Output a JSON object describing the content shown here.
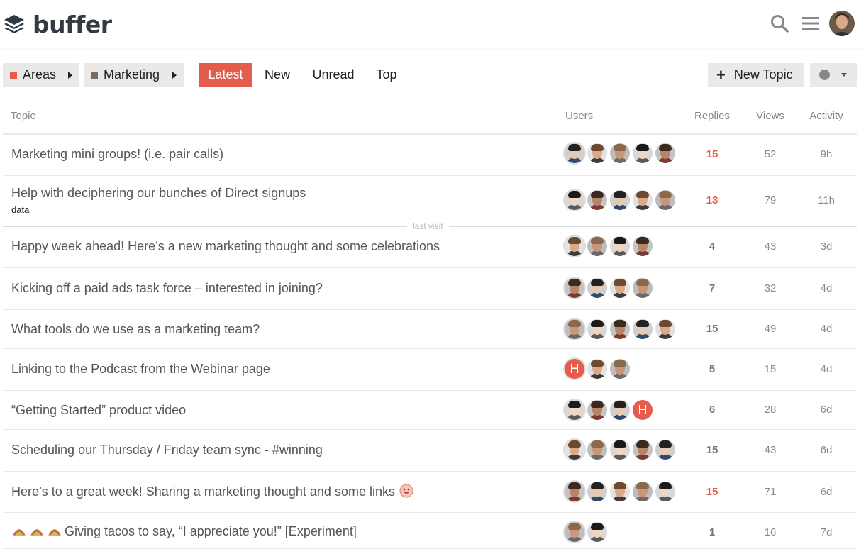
{
  "brand": {
    "name": "buffer"
  },
  "colors": {
    "accent": "#e45c4b",
    "areas": "#e45c4b",
    "marketing": "#7a6a5e",
    "hot_reply": "#e45c4b"
  },
  "nav": {
    "breadcrumbs": [
      {
        "label": "Areas"
      },
      {
        "label": "Marketing"
      }
    ],
    "tabs": [
      {
        "label": "Latest",
        "active": true
      },
      {
        "label": "New"
      },
      {
        "label": "Unread"
      },
      {
        "label": "Top"
      }
    ],
    "new_topic_label": "New Topic"
  },
  "columns": {
    "topic": "Topic",
    "users": "Users",
    "replies": "Replies",
    "views": "Views",
    "activity": "Activity"
  },
  "last_visit_label": "last visit",
  "topics": [
    {
      "title": "Marketing mini groups! (i.e. pair calls)",
      "tag": "",
      "posters": [
        "avatar",
        "avatar",
        "avatar",
        "avatar",
        "avatar"
      ],
      "replies": "15",
      "hot": true,
      "views": "52",
      "activity": "9h"
    },
    {
      "title": "Help with deciphering our bunches of Direct signups",
      "tag": "data",
      "posters": [
        "avatar",
        "avatar",
        "avatar",
        "avatar",
        "avatar"
      ],
      "replies": "13",
      "hot": true,
      "views": "79",
      "activity": "11h"
    },
    {
      "title": "Happy week ahead! Here’s a new marketing thought and some celebrations",
      "tag": "",
      "posters": [
        "avatar",
        "avatar",
        "avatar",
        "avatar"
      ],
      "replies": "4",
      "hot": false,
      "views": "43",
      "activity": "3d"
    },
    {
      "title": "Kicking off a paid ads task force – interested in joining?",
      "tag": "",
      "posters": [
        "avatar",
        "avatar",
        "avatar",
        "avatar"
      ],
      "replies": "7",
      "hot": false,
      "views": "32",
      "activity": "4d"
    },
    {
      "title": "What tools do we use as a marketing team?",
      "tag": "",
      "posters": [
        "avatar",
        "avatar",
        "avatar",
        "avatar",
        "avatar"
      ],
      "replies": "15",
      "hot": false,
      "views": "49",
      "activity": "4d"
    },
    {
      "title": "Linking to the Podcast from the Webinar page",
      "tag": "",
      "posters": [
        "H",
        "avatar",
        "avatar"
      ],
      "replies": "5",
      "hot": false,
      "views": "15",
      "activity": "4d"
    },
    {
      "title": "“Getting Started” product video",
      "tag": "",
      "posters": [
        "avatar",
        "avatar",
        "avatar",
        "H"
      ],
      "replies": "6",
      "hot": false,
      "views": "28",
      "activity": "6d"
    },
    {
      "title": "Scheduling our Thursday / Friday team sync - #winning",
      "tag": "",
      "posters": [
        "avatar",
        "avatar",
        "avatar",
        "avatar",
        "avatar"
      ],
      "replies": "15",
      "hot": false,
      "views": "43",
      "activity": "6d"
    },
    {
      "title": "Here’s to a great week! Sharing a marketing thought and some links",
      "tag": "",
      "posters": [
        "avatar",
        "avatar",
        "avatar",
        "avatar",
        "avatar"
      ],
      "replies": "15",
      "hot": true,
      "views": "71",
      "activity": "6d"
    },
    {
      "title": "Giving tacos to say, “I appreciate you!” [Experiment]",
      "tag": "",
      "posters": [
        "avatar",
        "avatar"
      ],
      "replies": "1",
      "hot": false,
      "views": "16",
      "activity": "7d"
    }
  ]
}
